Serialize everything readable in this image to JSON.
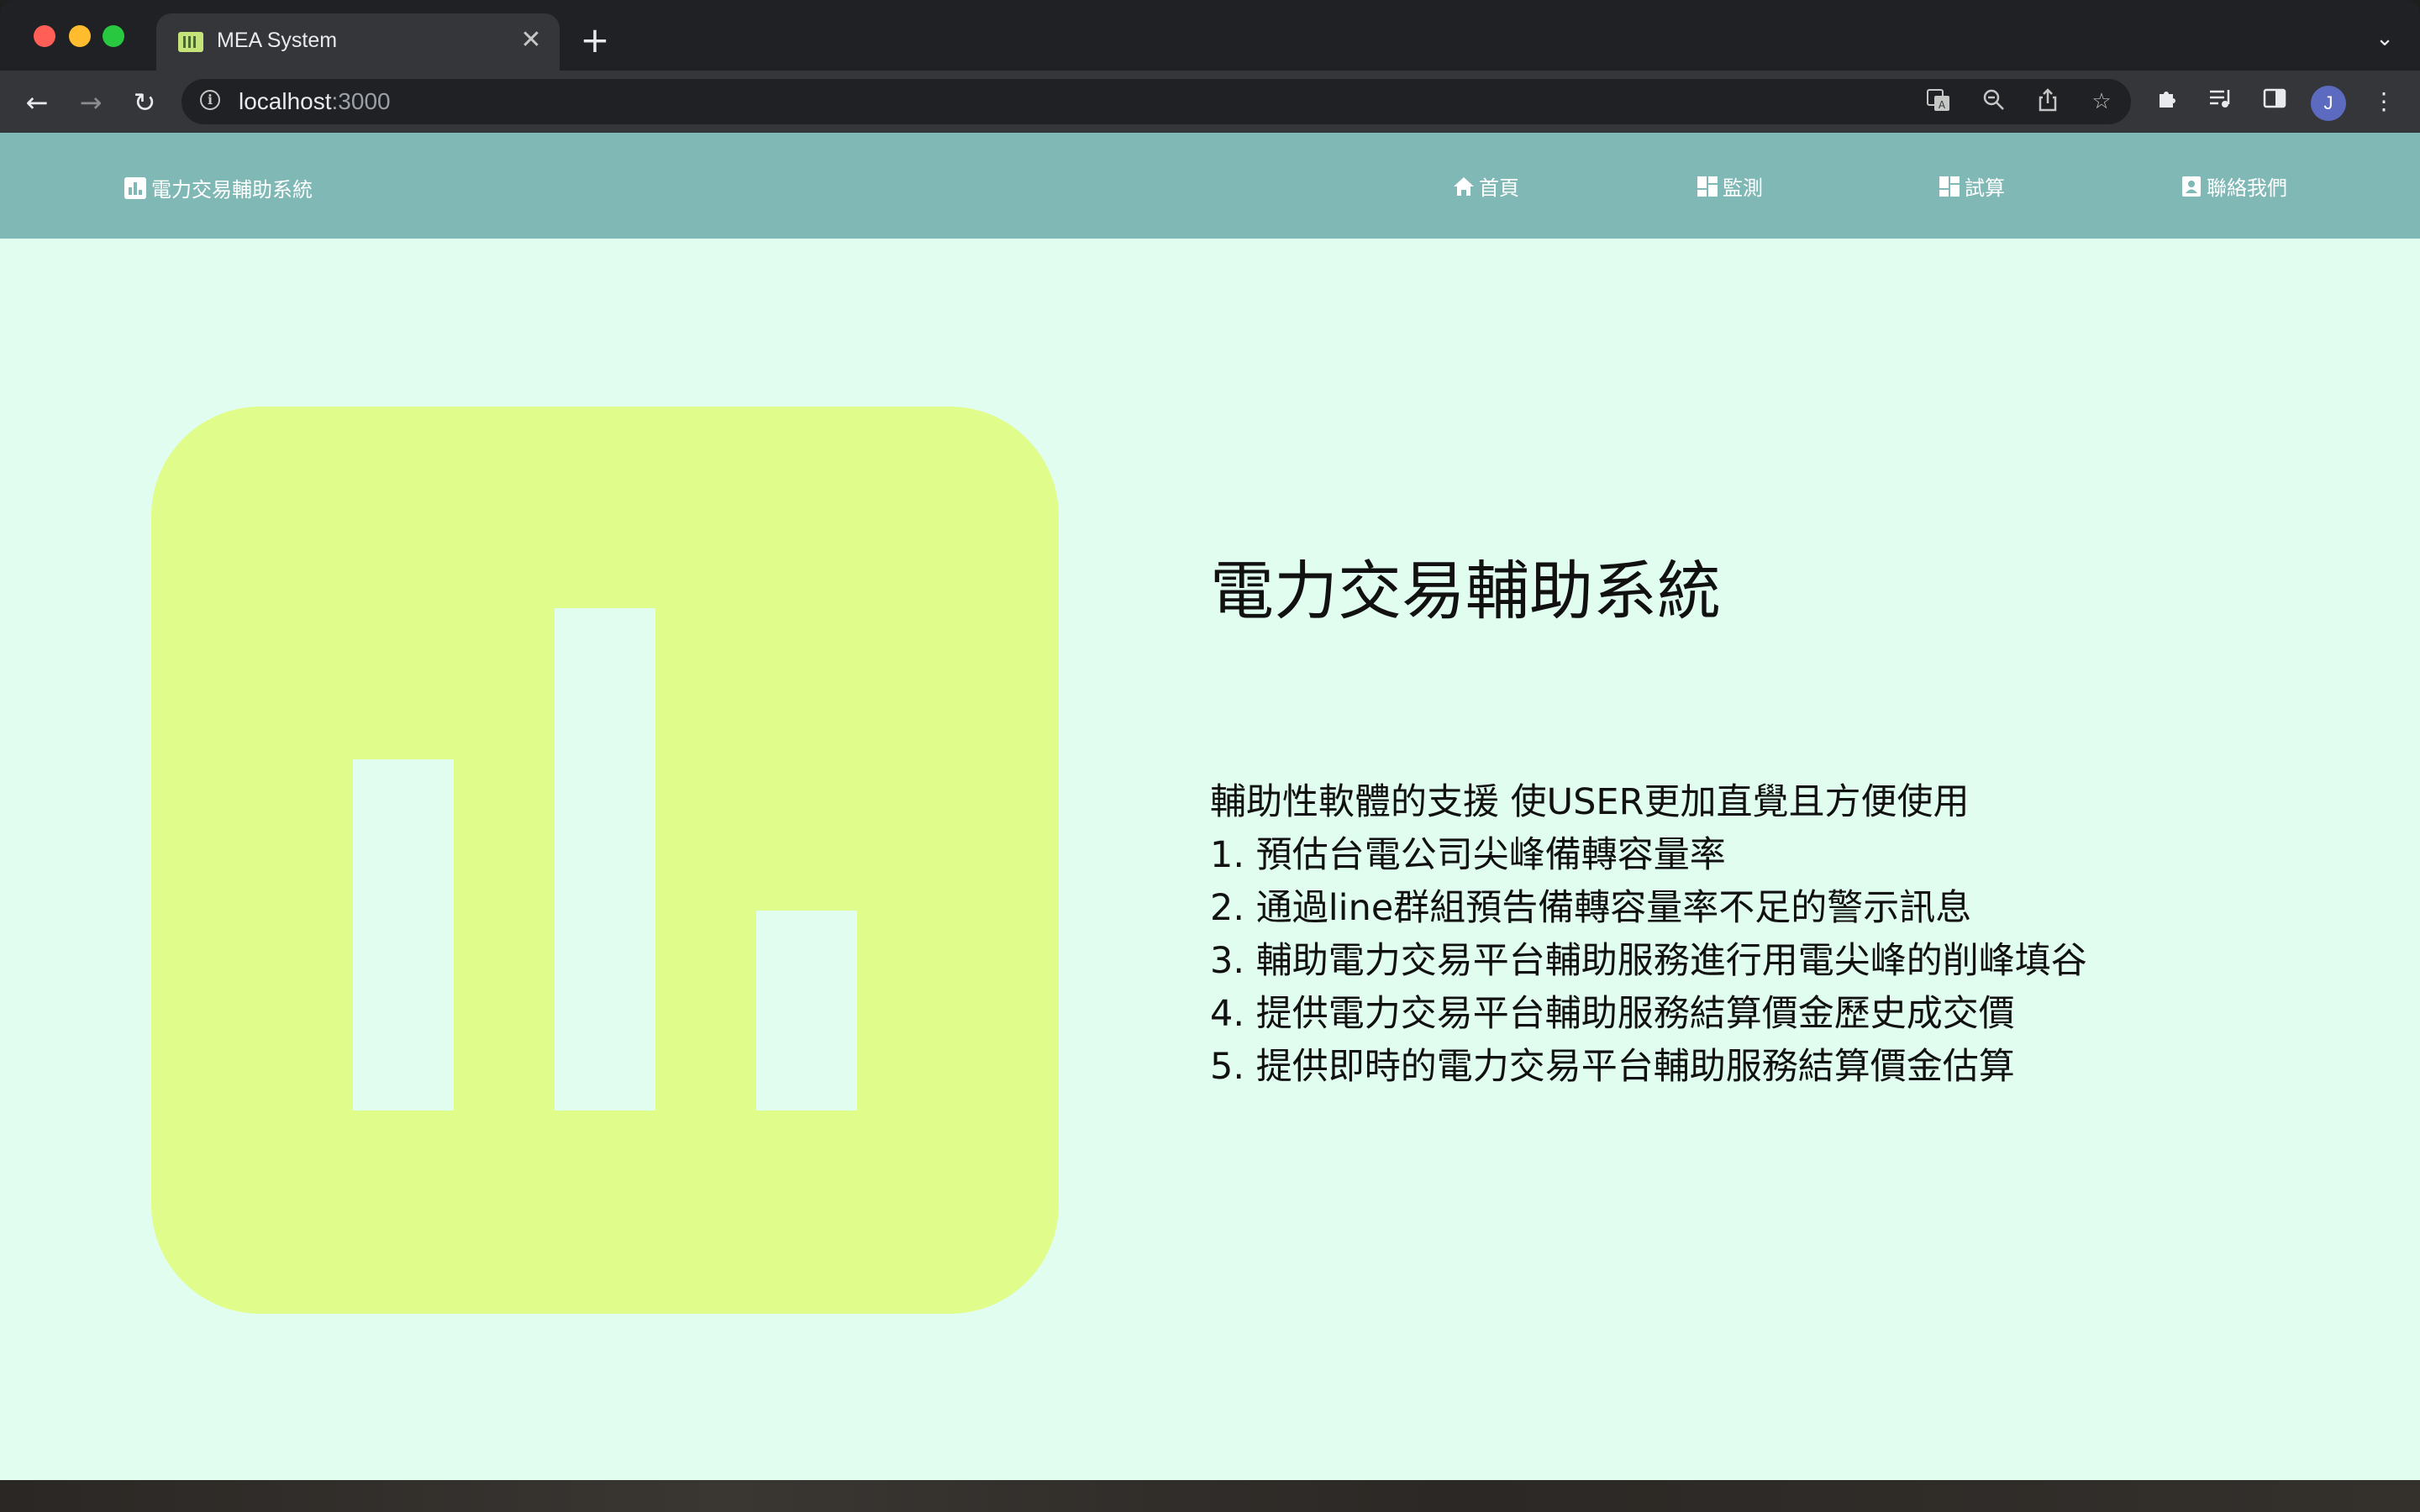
{
  "browser": {
    "tab_title": "MEA System",
    "url_host": "localhost",
    "url_port": ":3000",
    "profile_initial": "J",
    "icons": {
      "back": "back-arrow-icon",
      "forward": "forward-arrow-icon",
      "reload": "reload-icon",
      "site_info": "info-icon",
      "translate": "translate-icon",
      "zoom": "zoom-out-icon",
      "share": "share-icon",
      "bookmark": "star-icon",
      "extensions": "puzzle-icon",
      "media": "media-queue-icon",
      "side_panel": "side-panel-icon",
      "menu": "kebab-menu-icon"
    }
  },
  "navbar": {
    "brand": "電力交易輔助系統",
    "links": [
      {
        "label": "首頁",
        "icon": "home-icon"
      },
      {
        "label": "監測",
        "icon": "dashboard-icon"
      },
      {
        "label": "試算",
        "icon": "dashboard-icon"
      },
      {
        "label": "聯絡我們",
        "icon": "contact-card-icon"
      }
    ]
  },
  "hero": {
    "title": "電力交易輔助系統",
    "intro": "輔助性軟體的支援 使USER更加直覺且方便使用",
    "items": [
      "1. 預估台電公司尖峰備轉容量率",
      "2. 通過line群組預告備轉容量率不足的警示訊息",
      "3. 輔助電力交易平台輔助服務進行用電尖峰的削峰填谷",
      "4. 提供電力交易平台輔助服務結算價金歷史成交價",
      "5. 提供即時的電力交易平台輔助服務結算價金估算"
    ]
  },
  "colors": {
    "navbar_bg": "#80b8b6",
    "page_bg": "#e0fdef",
    "card_bg": "#e0fd8b"
  }
}
